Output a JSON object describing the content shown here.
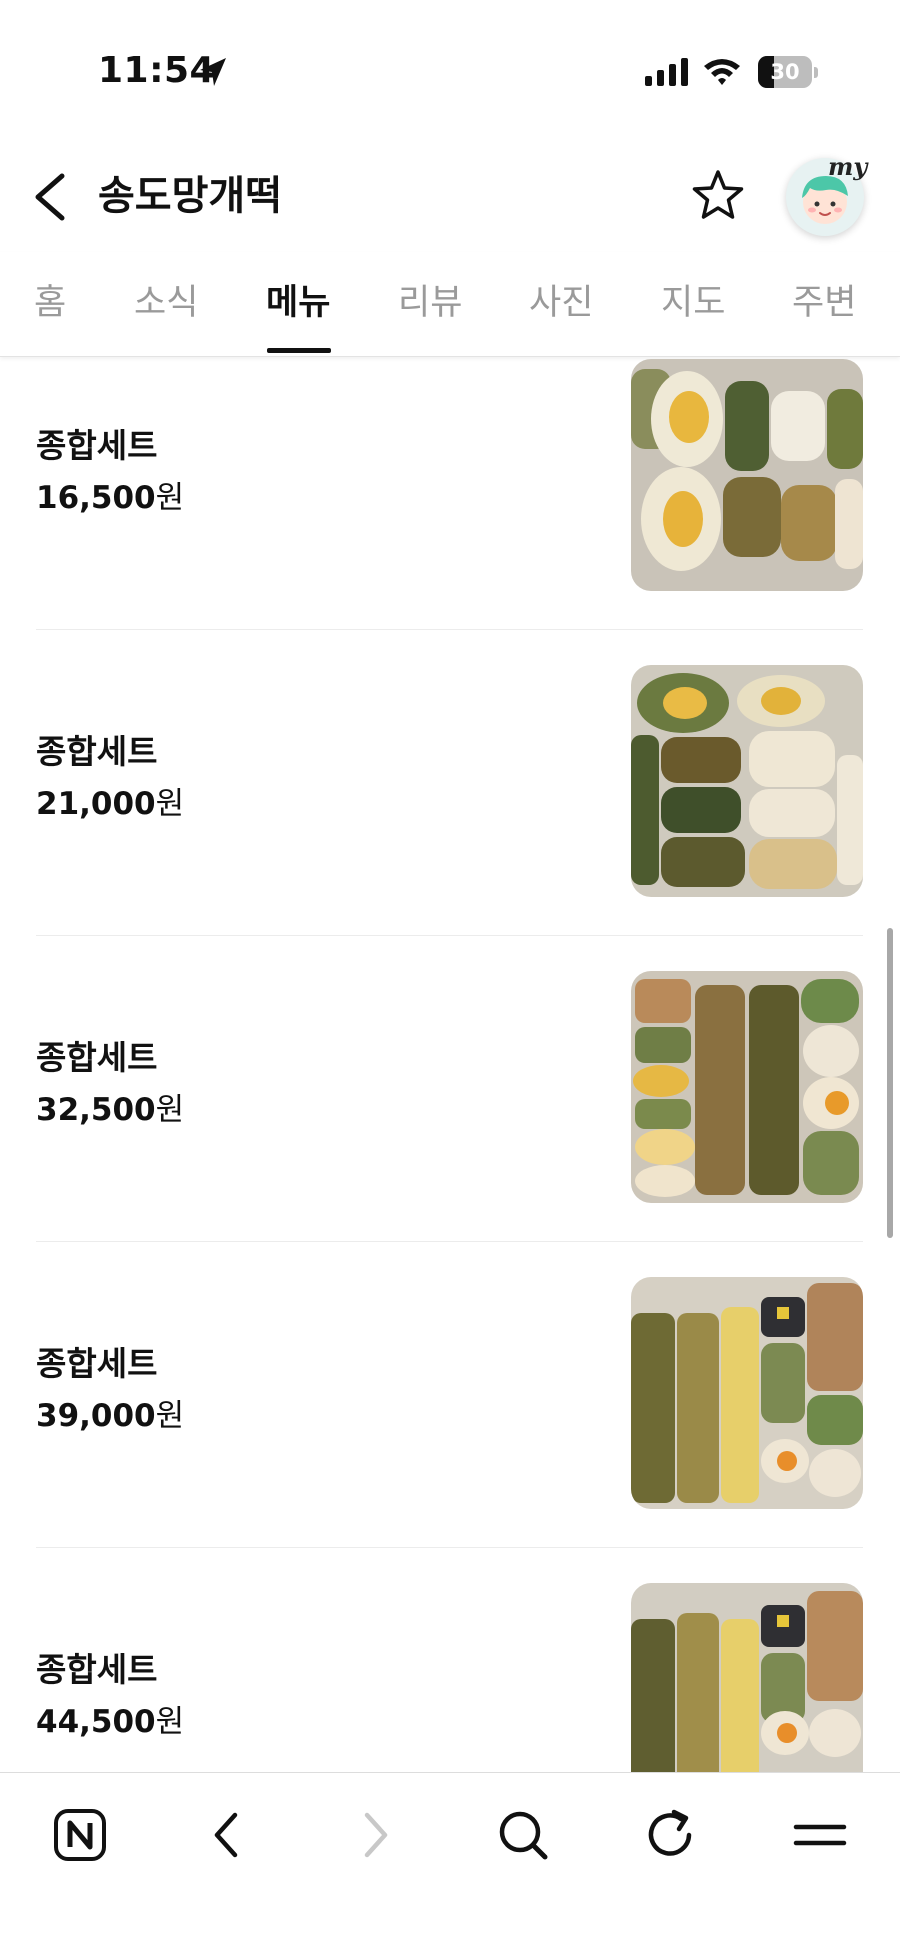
{
  "status_bar": {
    "time": "11:54",
    "battery": "30",
    "battery_level": 0.3
  },
  "header": {
    "title": "송도망개떡",
    "avatar_badge": "my"
  },
  "tabs": [
    {
      "label": "홈"
    },
    {
      "label": "소식"
    },
    {
      "label": "메뉴",
      "active": true
    },
    {
      "label": "리뷰"
    },
    {
      "label": "사진"
    },
    {
      "label": "지도"
    },
    {
      "label": "주변"
    }
  ],
  "menu": {
    "items": [
      {
        "name": "종합세트",
        "price": "16,500",
        "unit": "원"
      },
      {
        "name": "종합세트",
        "price": "21,000",
        "unit": "원"
      },
      {
        "name": "종합세트",
        "price": "32,500",
        "unit": "원"
      },
      {
        "name": "종합세트",
        "price": "39,000",
        "unit": "원"
      },
      {
        "name": "종합세트",
        "price": "44,500",
        "unit": "원"
      }
    ]
  },
  "toolbar": {
    "icons": [
      "naver-home-icon",
      "back-icon",
      "forward-icon",
      "search-icon",
      "refresh-icon",
      "menu-icon"
    ]
  },
  "colors": {
    "text": "#111111",
    "inactive_tab": "#9a9a9a",
    "divider": "#ececec",
    "disabled": "#c8c8c8"
  }
}
